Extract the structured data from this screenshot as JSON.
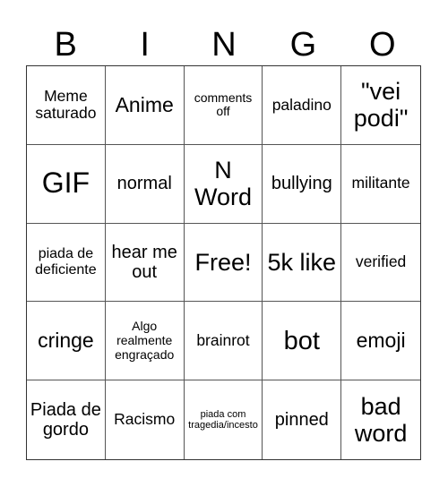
{
  "header": [
    "B",
    "I",
    "N",
    "G",
    "O"
  ],
  "cells": [
    "Meme saturado",
    "Anime",
    "comments off",
    "paladino",
    "\"vei podi\"",
    "GIF",
    "normal",
    "N Word",
    "bullying",
    "militante",
    "piada de deficiente",
    "hear me out",
    "Free!",
    "5k like",
    "verified",
    "cringe",
    "Algo realmente engraçado",
    "brainrot",
    "bot",
    "emoji",
    "Piada de gordo",
    "Racismo",
    "piada com tragedia/incesto",
    "pinned",
    "bad word"
  ]
}
